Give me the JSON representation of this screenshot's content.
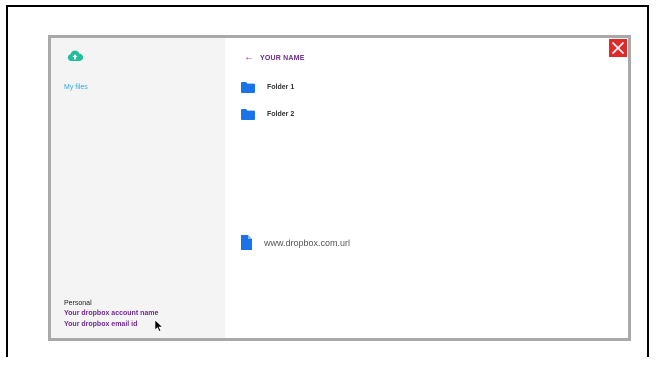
{
  "sidebar": {
    "nav_items": [
      {
        "label": "My files"
      }
    ],
    "account": {
      "label": "Personal",
      "name": "Your dropbox account name",
      "email": "Your dropbox email id"
    }
  },
  "header": {
    "title": "YOUR NAME"
  },
  "folders": [
    {
      "label": "Folder 1",
      "icon": "folder-icon"
    },
    {
      "label": "Folder 2",
      "icon": "folder-icon"
    }
  ],
  "files": [
    {
      "label": "www.dropbox.com.url",
      "icon": "file-icon"
    }
  ],
  "colors": {
    "accent": "#6e2a8e",
    "link": "#2aa9e0",
    "cloud": "#1fbf9a",
    "folder": "#1a73e8",
    "close": "#e02a2a"
  }
}
